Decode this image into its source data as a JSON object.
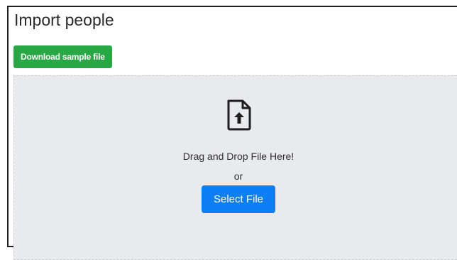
{
  "page": {
    "title": "Import people"
  },
  "actions": {
    "download_label": "Download sample file"
  },
  "dropzone": {
    "icon": "file-upload-icon",
    "drop_text": "Drag and Drop File Here!",
    "or_text": "or",
    "select_label": "Select File"
  },
  "colors": {
    "download_button": "#28a745",
    "select_button": "#0d7ff5",
    "dropzone_background": "#e8eaed"
  }
}
